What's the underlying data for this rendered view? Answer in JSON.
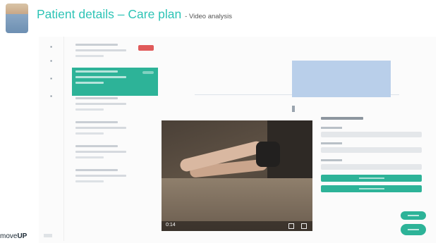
{
  "slide": {
    "title": "Patient details – Care plan",
    "subtitle": "- Video analysis"
  },
  "brand": {
    "prefix": "move",
    "suffix": "UP"
  },
  "video": {
    "timestamp": "0:14"
  },
  "colors": {
    "title_teal": "#2ec4b6",
    "accent_green": "#2db398",
    "alert_red": "#e05a5a",
    "chart_bar_blue": "#b9cfea"
  },
  "icons": {
    "nav": [
      "grid-icon",
      "chart-icon",
      "list-icon",
      "calendar-icon"
    ]
  }
}
